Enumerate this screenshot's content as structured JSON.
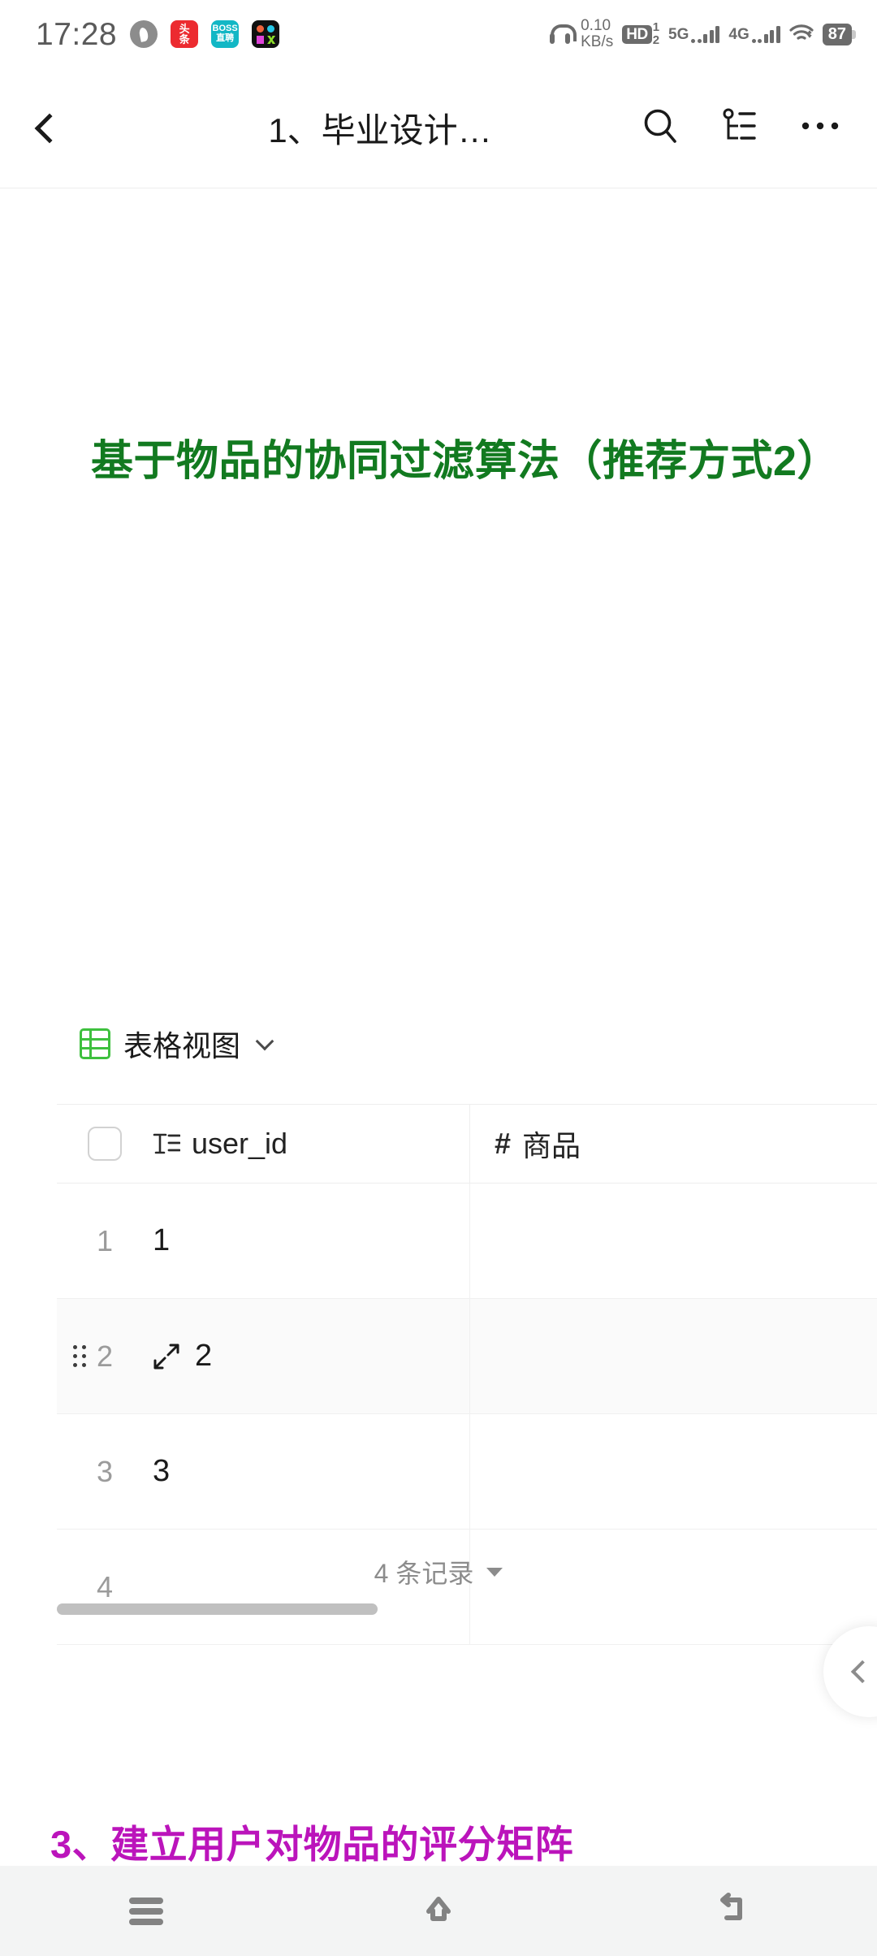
{
  "status_bar": {
    "time": "17:28",
    "app_icons": [
      {
        "name": "browser-flame-icon",
        "label": ""
      },
      {
        "name": "toutiao-icon",
        "label_top": "头",
        "label_bottom": "条"
      },
      {
        "name": "boss-zhipin-icon",
        "label_top": "BOSS",
        "label_bottom": "直聘"
      },
      {
        "name": "colorful-dots-app-icon",
        "label": ""
      }
    ],
    "headphone_icon": "headphone-icon",
    "net_speed_value": "0.10",
    "net_speed_unit": "KB/s",
    "hd_label": "HD",
    "hd_sub_top": "1",
    "hd_sub_bottom": "2",
    "sim1_network": "5G",
    "sim2_network": "4G",
    "wifi_icon": "wifi-icon",
    "battery_level": "87"
  },
  "header": {
    "back_icon": "chevron-left-icon",
    "title": "1、毕业设计…",
    "search_icon": "search-icon",
    "outline_icon": "outline-tree-icon",
    "more_icon": "more-horizontal-icon"
  },
  "document": {
    "green_heading": "基于物品的协同过滤算法（推荐方式2）",
    "purple_heading": "3、建立用户对物品的评分矩阵"
  },
  "table_block": {
    "view_icon": "table-grid-icon",
    "view_label": "表格视图",
    "view_chevron_icon": "chevron-down-icon",
    "select_all_checkbox": "select-all-checkbox",
    "columns": [
      {
        "icon": "text-type-icon",
        "label": "user_id"
      },
      {
        "icon": "number-type-icon",
        "label": "商品"
      }
    ],
    "rows": [
      {
        "number": "1",
        "user_id": "1",
        "col2": "",
        "highlighted": false
      },
      {
        "number": "2",
        "user_id": "2",
        "col2": "",
        "highlighted": true
      },
      {
        "number": "3",
        "user_id": "3",
        "col2": "",
        "highlighted": false
      },
      {
        "number": "4",
        "user_id": "",
        "col2": "",
        "highlighted": false
      }
    ],
    "record_count_label": "4 条记录",
    "record_count_caret_icon": "caret-down-icon",
    "scrollbar": "horizontal-scrollbar"
  },
  "side_panel_handle": {
    "icon": "chevron-left-icon"
  },
  "nav_bar": {
    "recents_icon": "recents-menu-icon",
    "home_icon": "home-icon",
    "back_icon": "back-arrow-icon"
  },
  "colors": {
    "green_heading": "#127a20",
    "purple_heading": "#bb14bb",
    "view_icon_green": "#3ec03e",
    "nav_bar_bg": "#f3f4f4",
    "row_highlight": "#fafafa"
  }
}
